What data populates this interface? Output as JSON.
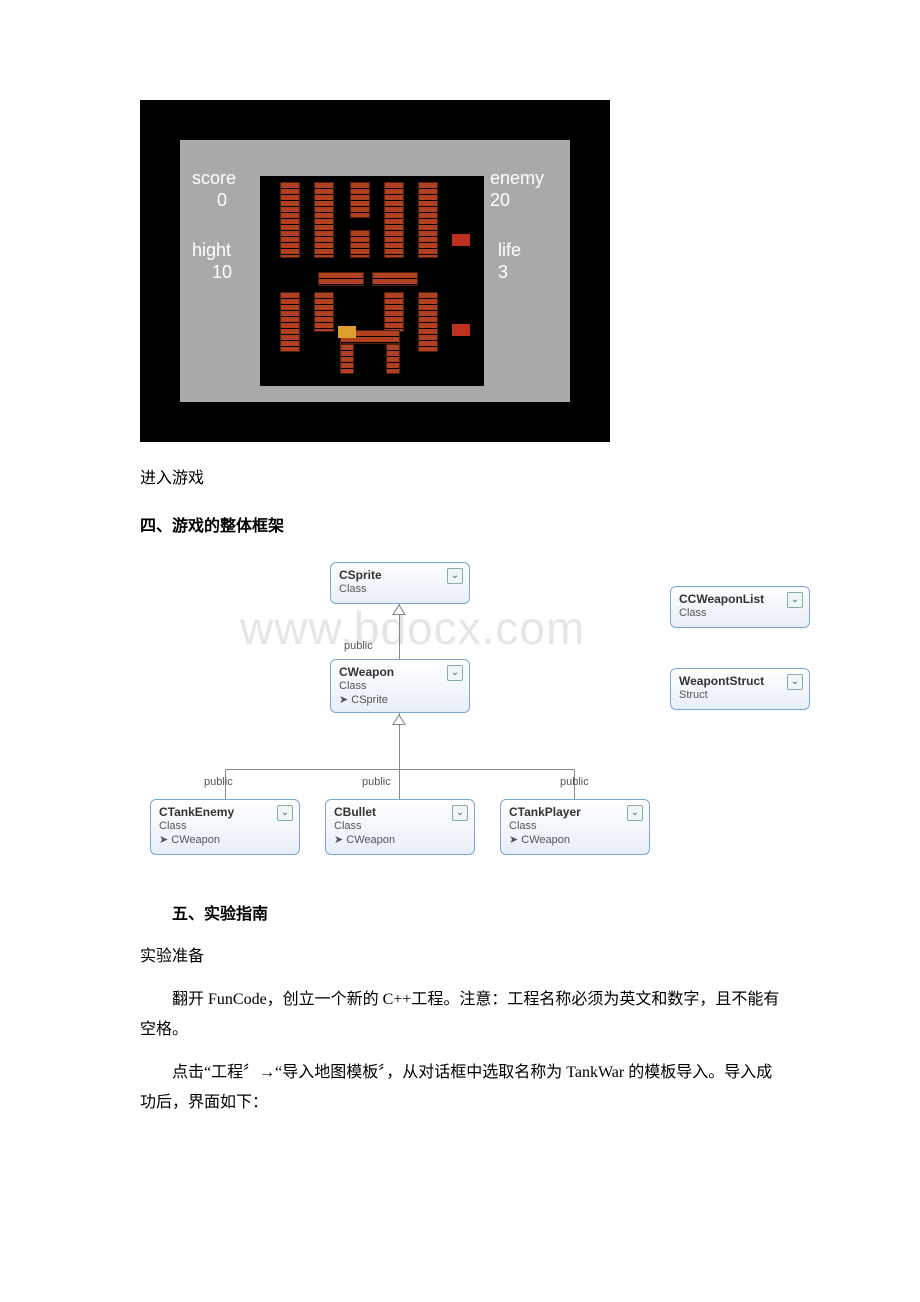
{
  "game": {
    "hud": {
      "score_label": "score",
      "score_value": "0",
      "hight_label": "hight",
      "hight_value": "10",
      "enemy_label": "enemy",
      "enemy_value": "20",
      "life_label": "life",
      "life_value": "3"
    }
  },
  "caption_enter_game": "进入游戏",
  "section4_title": "四、游戏的整体框架",
  "diagram": {
    "watermark": "www.bdocx.com",
    "csprite": {
      "name": "CSprite",
      "type": "Class"
    },
    "cweapon": {
      "name": "CWeapon",
      "type": "Class",
      "inherits": "CSprite"
    },
    "cweaponlist": {
      "name": "CCWeaponList",
      "type": "Class"
    },
    "weaponstruct": {
      "name": "WeapontStruct",
      "type": "Struct"
    },
    "ctankenemy": {
      "name": "CTankEnemy",
      "type": "Class",
      "inherits": "CWeapon"
    },
    "cbullet": {
      "name": "CBullet",
      "type": "Class",
      "inherits": "CWeapon"
    },
    "ctankplayer": {
      "name": "CTankPlayer",
      "type": "Class",
      "inherits": "CWeapon"
    },
    "label_public": "public"
  },
  "section5_title": "五、实验指南",
  "para_prep": "实验准备",
  "para_open": "翻开 FunCode，创立一个新的 C++工程。注意：工程名称必须为英文和数字，且不能有空格。",
  "para_import": "点击“工程〞→“导入地图模板〞，从对话框中选取名称为 TankWar 的模板导入。导入成功后，界面如下："
}
